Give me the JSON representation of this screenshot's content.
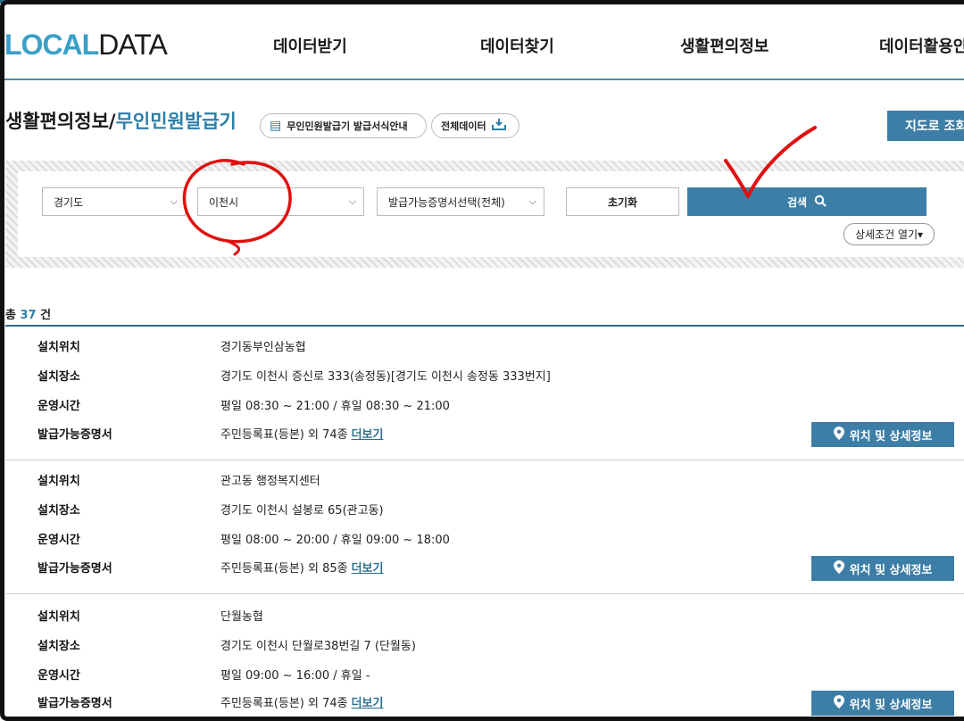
{
  "logo": {
    "part1": "LOCAL",
    "part2": "DATA"
  },
  "nav": [
    "데이터받기",
    "데이터찾기",
    "생활편의정보",
    "데이터활용안"
  ],
  "title": {
    "main": "생활편의정보/",
    "sub": "무인민원발급기"
  },
  "buttons": {
    "guide": "무인민원발급기 발급서식안내",
    "all_data": "전체데이터",
    "map_view": "지도로 조회",
    "reset": "초기화",
    "search": "검색",
    "detail_toggle": "상세조건 열기▾"
  },
  "filters": {
    "province": "경기도",
    "city": "이천시",
    "certificate": "발급가능증명서선택(전체)"
  },
  "results": {
    "total_prefix": "총",
    "total": "37",
    "total_suffix": "건",
    "labels": {
      "location": "설치위치",
      "place": "설치장소",
      "hours": "운영시간",
      "certs": "발급가능증명서"
    },
    "more_label": "더보기",
    "detail_button": "위치 및 상세정보",
    "items": [
      {
        "location": "경기동부인삼농협",
        "place": "경기도 이천시 증신로 333(송정동)[경기도 이천시 송정동 333번지]",
        "hours": "평일 08:30 ~ 21:00 / 휴일 08:30 ~ 21:00",
        "certs": "주민등록표(등본) 외 74종"
      },
      {
        "location": "관고동 행정복지센터",
        "place": "경기도 이천시 설봉로 65(관고동)",
        "hours": "평일 08:00 ~ 20:00 / 휴일 09:00 ~ 18:00",
        "certs": "주민등록표(등본) 외 85종"
      },
      {
        "location": "단월농협",
        "place": "경기도 이천시 단월로38번길 7 (단월동)",
        "hours": "평일 09:00 ~ 16:00 / 휴일 -",
        "certs": "주민등록표(등본) 외 74종"
      }
    ]
  },
  "colors": {
    "accent": "#3d7ea6",
    "logo_blue": "#3aa0c8",
    "annotation": "#e01010"
  }
}
